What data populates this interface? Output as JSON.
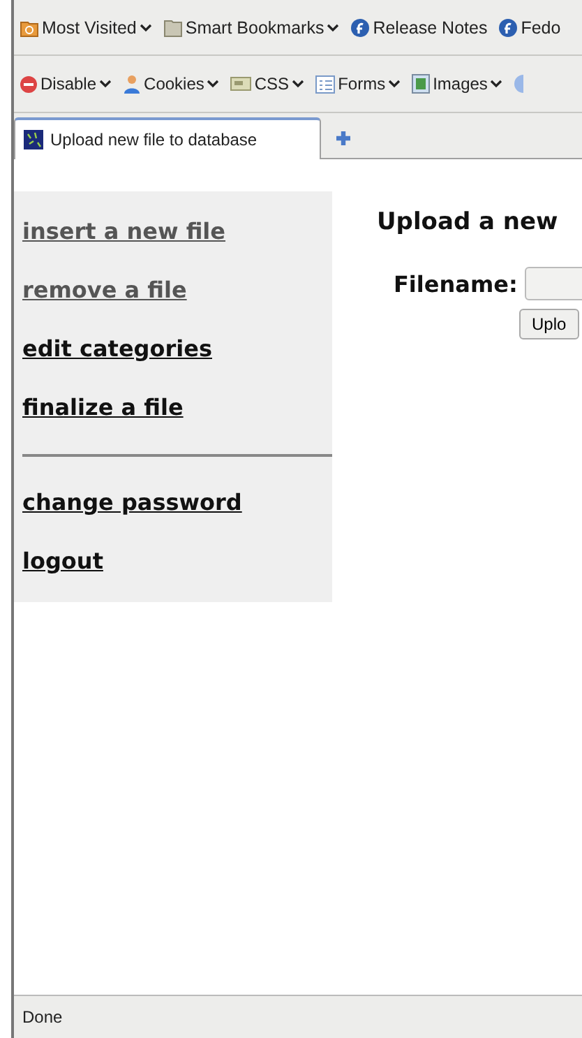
{
  "bookmarks": [
    {
      "label": "Most Visited",
      "kind": "folder-star",
      "dropdown": true
    },
    {
      "label": "Smart Bookmarks",
      "kind": "folder",
      "dropdown": true
    },
    {
      "label": "Release Notes",
      "kind": "fedora",
      "dropdown": false
    },
    {
      "label": "Fedo",
      "kind": "fedora",
      "dropdown": false
    }
  ],
  "toolbar": [
    {
      "label": "Disable",
      "kind": "stop"
    },
    {
      "label": "Cookies",
      "kind": "person"
    },
    {
      "label": "CSS",
      "kind": "card"
    },
    {
      "label": "Forms",
      "kind": "form"
    },
    {
      "label": "Images",
      "kind": "image"
    }
  ],
  "tabs": [
    {
      "label": "Upload new file to database",
      "selected": true
    }
  ],
  "sidebar": {
    "groups": [
      [
        {
          "label": "insert a new file",
          "visited": true
        },
        {
          "label": "remove a file",
          "visited": true
        },
        {
          "label": "edit categories",
          "visited": false
        },
        {
          "label": "finalize a file",
          "visited": false
        }
      ],
      [
        {
          "label": "change password",
          "visited": false
        },
        {
          "label": "logout",
          "visited": false
        }
      ]
    ]
  },
  "main": {
    "heading": "Upload a new",
    "field_label": "Filename:",
    "button": "Uplo"
  },
  "status_bar": "Done"
}
